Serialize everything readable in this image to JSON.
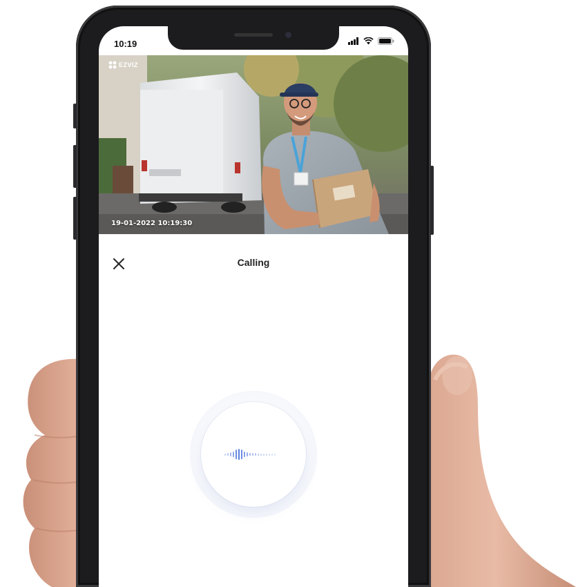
{
  "status_bar": {
    "time": "10:19",
    "icons": [
      "signal-icon",
      "wifi-icon",
      "battery-icon"
    ]
  },
  "video_feed": {
    "brand_logo": "EZVIZ",
    "timestamp": "19-01-2022 10:19:30"
  },
  "call": {
    "title": "Calling",
    "close_icon": "close-icon",
    "indicator_icon": "voice-wave-icon"
  },
  "colors": {
    "accent": "#5b7fe0",
    "title_text": "#222222",
    "phone_frame": "#1c1c1e"
  }
}
